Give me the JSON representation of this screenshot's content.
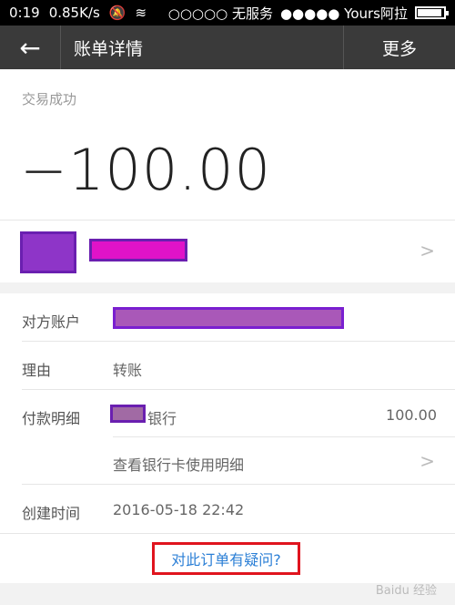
{
  "status_bar": {
    "time": "0:19",
    "speed": "0.85K/s",
    "signal_carrier_1": "○○○○○ 无服务",
    "signal_carrier_2": "●●●●● Yours阿拉"
  },
  "titlebar": {
    "back_label": "←",
    "title": "账单详情",
    "more_label": "更多"
  },
  "transaction": {
    "status": "交易成功",
    "amount": "−100.00"
  },
  "details": {
    "account_label": "对方账户",
    "reason_label": "理由",
    "reason_value": "转账",
    "payment_label": "付款明细",
    "payment_bank_suffix": "银行",
    "payment_amount": "100.00",
    "view_card_detail": "查看银行卡使用明细",
    "created_label": "创建时间",
    "created_value": "2016-05-18 22:42",
    "question_link": "对此订单有疑问?"
  },
  "watermark": "Baidu 经验"
}
